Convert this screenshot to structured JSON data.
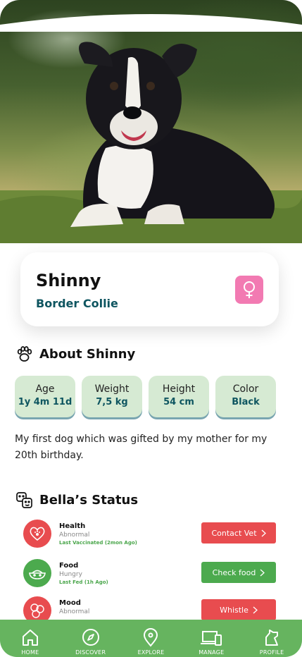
{
  "pet": {
    "name": "Shinny",
    "breed": "Border Collie",
    "gender_icon": "female-icon",
    "photo_description_icon": "dog-photo"
  },
  "about": {
    "title": "About Shinny",
    "icon": "paw-icon",
    "stats": [
      {
        "label": "Age",
        "value": "1y 4m 11d"
      },
      {
        "label": "Weight",
        "value": "7,5 kg"
      },
      {
        "label": "Height",
        "value": "54 cm"
      },
      {
        "label": "Color",
        "value": "Black"
      }
    ],
    "description": "My first dog which was gifted by my mother for my 20th birthday."
  },
  "status": {
    "title": "Bella’s Status",
    "icon": "status-faces-icon",
    "items": [
      {
        "title": "Health",
        "subtitle": "Abnormal",
        "note": "Last Vaccinated (2mon Ago)",
        "button": "Contact Vet",
        "icon": "heart-paw-icon"
      },
      {
        "title": "Food",
        "subtitle": "Hungry",
        "note": "Last Fed (1h Ago)",
        "button": "Check food",
        "icon": "food-bowl-icon"
      },
      {
        "title": "Mood",
        "subtitle": "Abnormal",
        "note": "",
        "button": "Whistle",
        "icon": "mood-icon"
      }
    ]
  },
  "nav": {
    "items": [
      {
        "label": "HOME",
        "icon": "home-icon"
      },
      {
        "label": "DISCOVER",
        "icon": "compass-icon"
      },
      {
        "label": "EXPLORE",
        "icon": "location-pin-icon"
      },
      {
        "label": "MANAGE",
        "icon": "devices-icon"
      },
      {
        "label": "PROFILE",
        "icon": "profile-icon"
      }
    ]
  },
  "colors": {
    "accent_green": "#4caa4e",
    "nav_green": "#66b45f",
    "alert_red": "#e84c4f",
    "teal_text": "#0e5560",
    "chip_bg": "#d6ead3",
    "gender_pink": "#f27ab2"
  }
}
